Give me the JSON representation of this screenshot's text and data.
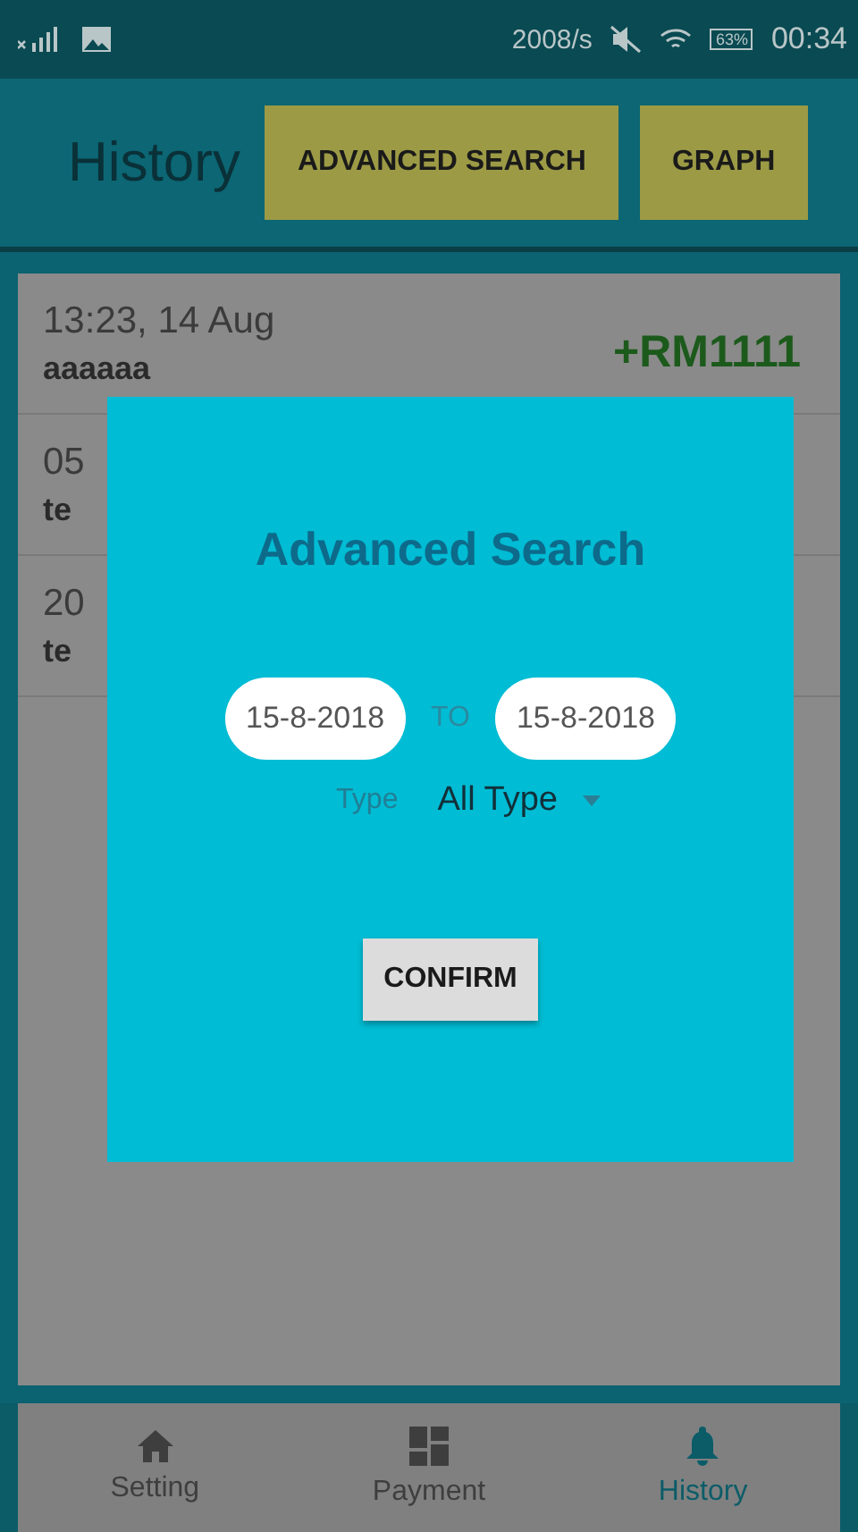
{
  "status_bar": {
    "speed": "2008/s",
    "battery": "63%",
    "time": "00:34"
  },
  "header": {
    "title": "History",
    "buttons": [
      "ADVANCED SEARCH",
      "GRAPH"
    ]
  },
  "rows": [
    {
      "time": "13:23, 14 Aug",
      "note": "aaaaaa",
      "amount": "+RM1111"
    },
    {
      "time": "05",
      "note": "te"
    },
    {
      "time": "20",
      "note": "te"
    }
  ],
  "dialog": {
    "title": "Advanced Search",
    "from": "15-8-2018",
    "separator": "TO",
    "to": "15-8-2018",
    "type_label": "Type",
    "type_value": "All Type",
    "confirm": "CONFIRM"
  },
  "nav": [
    {
      "label": "Setting",
      "selected": false
    },
    {
      "label": "Payment",
      "selected": false
    },
    {
      "label": "History",
      "selected": true
    }
  ]
}
